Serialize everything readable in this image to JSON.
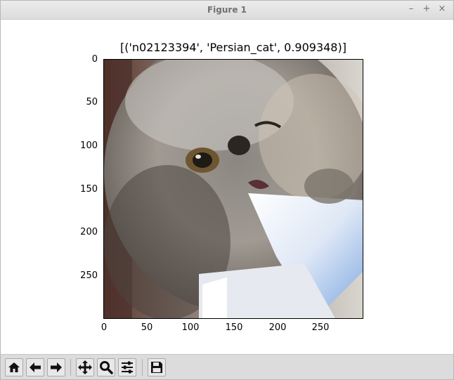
{
  "window": {
    "title": "Figure 1",
    "controls": {
      "minimize": "–",
      "maximize": "+",
      "close": "×"
    }
  },
  "figure": {
    "title": "[('n02123394', 'Persian_cat', 0.909348)]",
    "image_description_icon": "cat-photo",
    "y_ticks": [
      "0",
      "50",
      "100",
      "150",
      "200",
      "250"
    ],
    "x_ticks": [
      "0",
      "50",
      "100",
      "150",
      "200",
      "250"
    ]
  },
  "toolbar": {
    "buttons": [
      {
        "name": "home",
        "icon": "home-icon"
      },
      {
        "name": "back",
        "icon": "arrow-left-icon"
      },
      {
        "name": "forward",
        "icon": "arrow-right-icon"
      },
      {
        "name": "pan",
        "icon": "move-icon"
      },
      {
        "name": "zoom",
        "icon": "magnifier-icon"
      },
      {
        "name": "configure-subplots",
        "icon": "sliders-icon"
      },
      {
        "name": "save",
        "icon": "floppy-disk-icon"
      }
    ]
  },
  "colors": {
    "titlebar_text": "#707070",
    "toolbar_bg": "#dcdcdc"
  }
}
